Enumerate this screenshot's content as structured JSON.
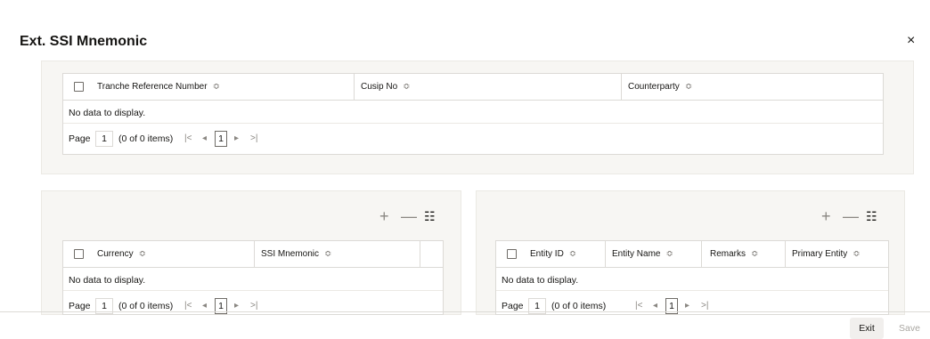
{
  "dialog": {
    "title": "Ext. SSI Mnemonic",
    "close_label": "×"
  },
  "tranche_table": {
    "columns": [
      "Tranche Reference Number",
      "Cusip No",
      "Counterparty"
    ],
    "sort_glyph": "≎",
    "empty_text": "No data to display.",
    "pager": {
      "page_label": "Page",
      "page_value": "1",
      "items_text": "(0 of 0 items)",
      "first": "|<",
      "prev": "◂",
      "current": "1",
      "next": "▸",
      "last": ">|"
    }
  },
  "currency_table": {
    "toolbar": {
      "add": "+",
      "remove": "—",
      "list": "☷"
    },
    "columns": [
      "Currency",
      "SSI Mnemonic"
    ],
    "empty_text": "No data to display.",
    "pager": {
      "page_label": "Page",
      "page_value": "1",
      "items_text": "(0 of 0 items)",
      "first": "|<",
      "prev": "◂",
      "current": "1",
      "next": "▸",
      "last": ">|"
    }
  },
  "entity_table": {
    "toolbar": {
      "add": "+",
      "remove": "—",
      "list": "☷"
    },
    "columns": [
      "Entity ID",
      "Entity Name",
      "Remarks",
      "Primary Entity"
    ],
    "empty_text": "No data to display.",
    "pager": {
      "page_label": "Page",
      "page_value": "1",
      "items_text": "(0 of 0 items)",
      "first": "|<",
      "prev": "◂",
      "current": "1",
      "next": "▸",
      "last": ">|"
    }
  },
  "footer": {
    "exit_label": "Exit",
    "save_label": "Save"
  }
}
